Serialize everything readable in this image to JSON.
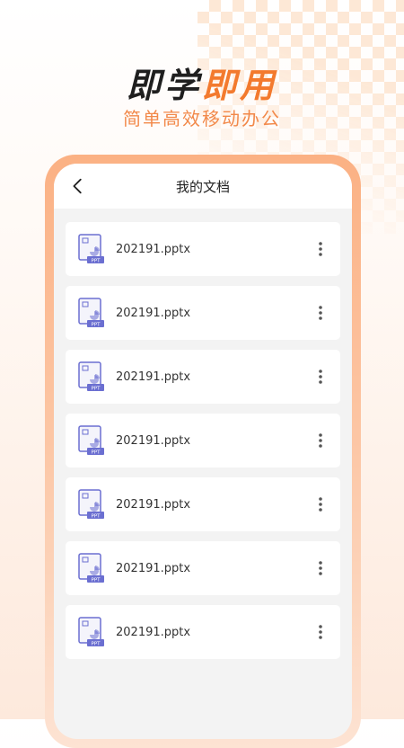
{
  "banner": {
    "slogan_part1": "即学",
    "slogan_part2": "即用",
    "subtitle": "简单高效移动办公"
  },
  "header": {
    "title": "我的文档",
    "back_icon": "back-arrow-icon"
  },
  "files": [
    {
      "name": "202191.pptx",
      "type_badge": "PPT"
    },
    {
      "name": "202191.pptx",
      "type_badge": "PPT"
    },
    {
      "name": "202191.pptx",
      "type_badge": "PPT"
    },
    {
      "name": "202191.pptx",
      "type_badge": "PPT"
    },
    {
      "name": "202191.pptx",
      "type_badge": "PPT"
    },
    {
      "name": "202191.pptx",
      "type_badge": "PPT"
    },
    {
      "name": "202191.pptx",
      "type_badge": "PPT"
    }
  ],
  "colors": {
    "accent": "#f37a2e",
    "file_icon": "#6b6fd1"
  }
}
